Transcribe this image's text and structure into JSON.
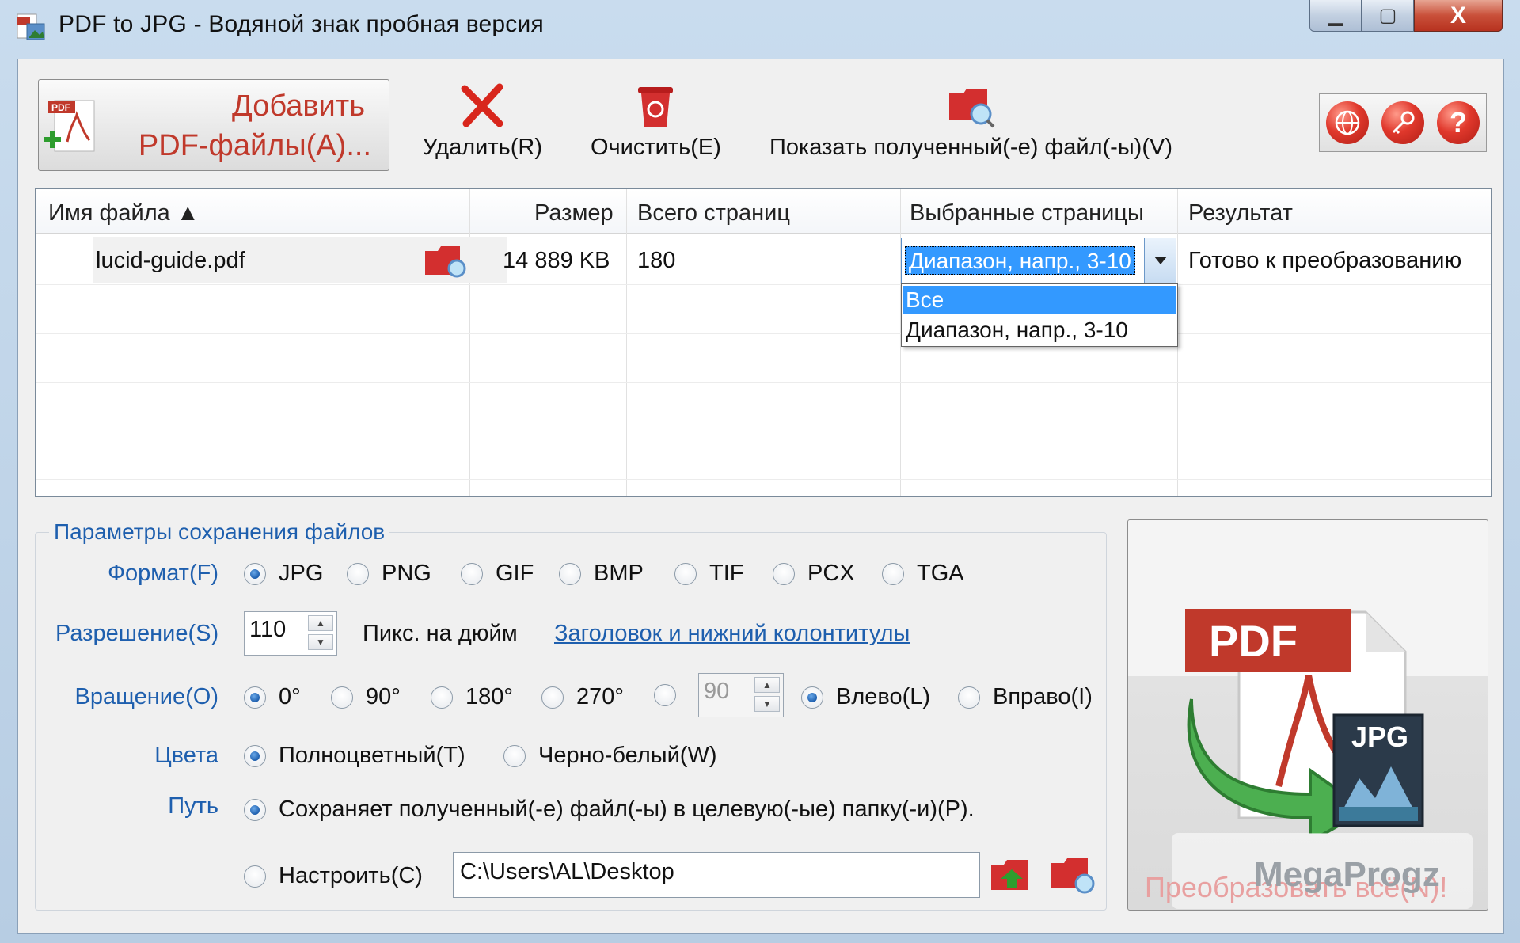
{
  "window": {
    "title": "PDF to JPG - Водяной знак пробная версия",
    "minimize_icon": "minimize-icon",
    "maximize_icon": "maximize-icon",
    "close_label": "X"
  },
  "toolbar": {
    "add_label_line1": "Добавить",
    "add_label_line2": "PDF-файлы(A)...",
    "delete_label": "Удалить(R)",
    "clear_label": "Очистить(E)",
    "show_label": "Показать полученный(-е) файл(-ы)(V)",
    "help_glyph": "?"
  },
  "table": {
    "columns": [
      "Имя файла ▲",
      "Размер",
      "Всего страниц",
      "Выбранные страницы",
      "Результат"
    ],
    "rows": [
      {
        "name": "lucid-guide.pdf",
        "size": "14 889 KB",
        "pages": "180",
        "selected": "Диапазон, напр., 3-10",
        "result": "Готово к преобразованию"
      }
    ],
    "dropdown_options": [
      "Все",
      "Диапазон, напр., 3-10"
    ]
  },
  "settings": {
    "group_title": "Параметры сохранения файлов",
    "format_label": "Формат(F)",
    "formats": [
      "JPG",
      "PNG",
      "GIF",
      "BMP",
      "TIF",
      "PCX",
      "TGA"
    ],
    "format_selected": "JPG",
    "resolution_label": "Разрешение(S)",
    "resolution_value": "110",
    "resolution_unit": "Пикс. на дюйм",
    "header_footer_link": "Заголовок и нижний колонтитулы",
    "rotation_label": "Вращение(O)",
    "rotations": [
      "0°",
      "90°",
      "180°",
      "270°"
    ],
    "rotation_custom_value": "90",
    "rotation_left": "Влево(L)",
    "rotation_right": "Вправо(I)",
    "colors_label": "Цвета",
    "color_full": "Полноцветный(T)",
    "color_bw": "Черно-белый(W)",
    "path_label": "Путь",
    "path_target": "Сохраняет полученный(-е) файл(-ы) в целевую(-ые) папку(-и)(P).",
    "path_custom": "Настроить(C)",
    "path_value": "C:\\Users\\AL\\Desktop"
  },
  "convert": {
    "label": "Преобразовать всё(N)!",
    "badge_pdf": "PDF",
    "badge_jpg": "JPG"
  },
  "watermark": "MegaProgz",
  "colors": {
    "accent_blue": "#1e5fae",
    "brand_red": "#c0392b",
    "selection": "#3399ff"
  }
}
